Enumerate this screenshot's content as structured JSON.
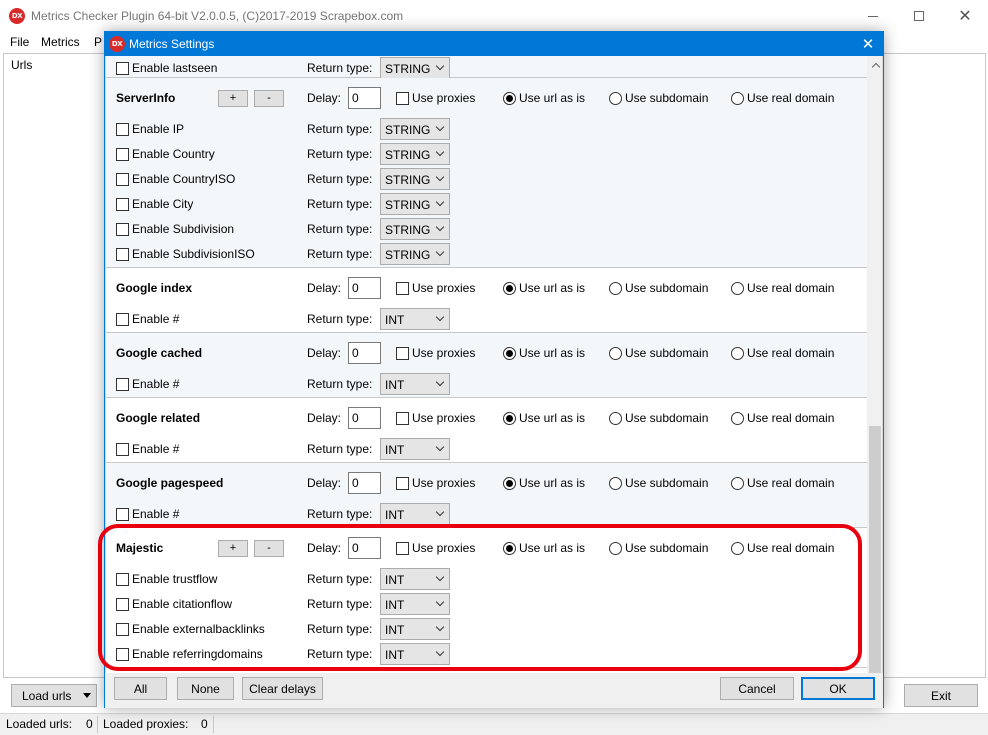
{
  "main_window": {
    "title": "Metrics Checker Plugin 64-bit V2.0.0.5, (C)2017-2019 Scrapebox.com",
    "logo_text": "DX",
    "controls": {
      "close": "✕"
    },
    "menu": [
      "File",
      "Metrics",
      "P"
    ],
    "urls_label": "Urls",
    "load_urls_label": "Load urls",
    "exit_label": "Exit",
    "status": {
      "loaded_urls_label": "Loaded urls:",
      "loaded_urls_value": "0",
      "loaded_proxies_label": "Loaded proxies:",
      "loaded_proxies_value": "0"
    }
  },
  "dialog": {
    "title": "Metrics Settings",
    "close": "✕",
    "labels": {
      "delay": "Delay:",
      "return_type": "Return type:",
      "use_proxies": "Use proxies",
      "use_url_as_is": "Use url as is",
      "use_subdomain": "Use subdomain",
      "use_real_domain": "Use real domain",
      "plus": "+",
      "minus": "-"
    },
    "partial_row": {
      "label": "Enable lastseen",
      "return_type": "STRING"
    },
    "sections": [
      {
        "title": "ServerInfo",
        "delay": "0",
        "has_buttons": true,
        "rows": [
          {
            "label": "Enable IP",
            "return_type": "STRING"
          },
          {
            "label": "Enable Country",
            "return_type": "STRING"
          },
          {
            "label": "Enable CountryISO",
            "return_type": "STRING"
          },
          {
            "label": "Enable City",
            "return_type": "STRING"
          },
          {
            "label": "Enable Subdivision",
            "return_type": "STRING"
          },
          {
            "label": "Enable SubdivisionISO",
            "return_type": "STRING"
          }
        ]
      },
      {
        "title": "Google index",
        "delay": "0",
        "has_buttons": false,
        "rows": [
          {
            "label": "Enable #",
            "return_type": "INT"
          }
        ]
      },
      {
        "title": "Google cached",
        "delay": "0",
        "has_buttons": false,
        "rows": [
          {
            "label": "Enable #",
            "return_type": "INT"
          }
        ]
      },
      {
        "title": "Google related",
        "delay": "0",
        "has_buttons": false,
        "rows": [
          {
            "label": "Enable #",
            "return_type": "INT"
          }
        ]
      },
      {
        "title": "Google pagespeed",
        "delay": "0",
        "has_buttons": false,
        "rows": [
          {
            "label": "Enable #",
            "return_type": "INT"
          }
        ]
      },
      {
        "title": "Majestic",
        "delay": "0",
        "has_buttons": true,
        "rows": [
          {
            "label": "Enable trustflow",
            "return_type": "INT"
          },
          {
            "label": "Enable citationflow",
            "return_type": "INT"
          },
          {
            "label": "Enable externalbacklinks",
            "return_type": "INT"
          },
          {
            "label": "Enable referringdomains",
            "return_type": "INT"
          }
        ]
      }
    ],
    "footer": {
      "all": "All",
      "none": "None",
      "clear_delays": "Clear delays",
      "cancel": "Cancel",
      "ok": "OK"
    }
  },
  "colors": {
    "accent": "#0078d7",
    "highlight": "#e8000f",
    "logo": "#d92a2a"
  }
}
